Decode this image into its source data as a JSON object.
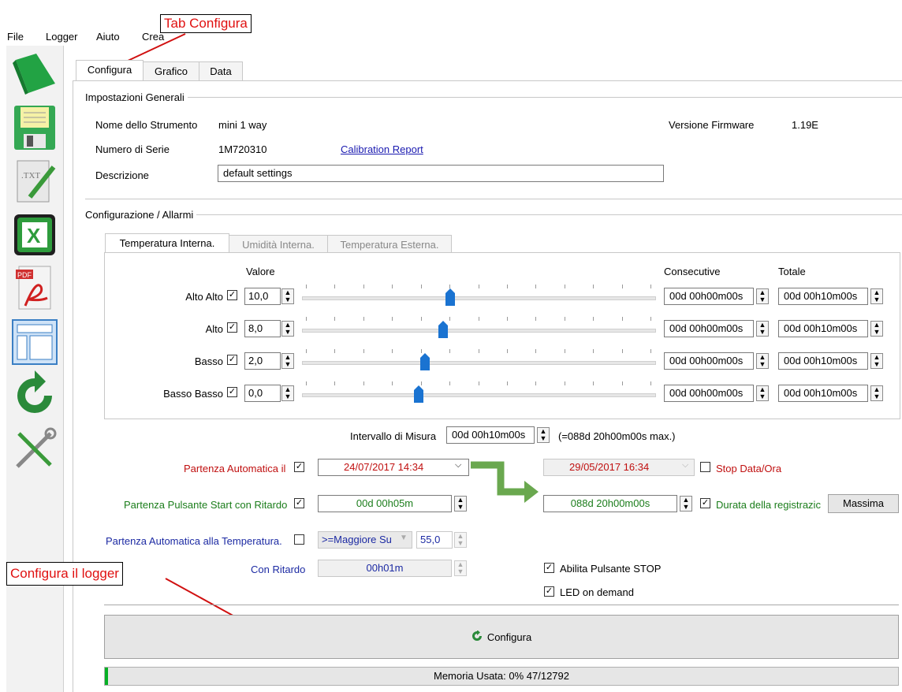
{
  "menu": [
    "File",
    "Logger",
    "Aiuto",
    "Crea"
  ],
  "callouts": {
    "tab": "Tab Configura",
    "logger": "Configura il logger"
  },
  "toolbar": [
    "open-icon",
    "save-icon",
    "txt-export-icon",
    "excel-export-icon",
    "pdf-export-icon",
    "layout-icon",
    "refresh-icon",
    "tools-icon"
  ],
  "tabs": [
    "Configura",
    "Grafico",
    "Data"
  ],
  "general": {
    "title": "Impostazioni Generali",
    "name_label": "Nome dello Strumento",
    "name_value": "mini 1 way",
    "firmware_label": "Versione Firmware",
    "firmware_value": "1.19E",
    "serial_label": "Numero di Serie",
    "serial_value": "1M720310",
    "calibration_link": "Calibration Report",
    "desc_label": "Descrizione",
    "desc_value": "default settings"
  },
  "alarms": {
    "title": "Configurazione / Allarmi",
    "tabs": [
      "Temperatura Interna.",
      "Umidità Interna.",
      "Temperatura Esterna."
    ],
    "col_value": "Valore",
    "col_consec": "Consecutive",
    "col_total": "Totale",
    "rows": [
      {
        "label": "Alto Alto",
        "value": "10,0",
        "consec": "00d 00h00m00s",
        "total": "00d 00h10m00s",
        "level": 0.42
      },
      {
        "label": "Alto",
        "value": "8,0",
        "consec": "00d 00h00m00s",
        "total": "00d 00h10m00s",
        "level": 0.4
      },
      {
        "label": "Basso",
        "value": "2,0",
        "consec": "00d 00h00m00s",
        "total": "00d 00h10m00s",
        "level": 0.35
      },
      {
        "label": "Basso Basso",
        "value": "0,0",
        "consec": "00d 00h00m00s",
        "total": "00d 00h10m00s",
        "level": 0.33
      }
    ]
  },
  "interval": {
    "label": "Intervallo di Misura",
    "value": "00d 00h10m00s",
    "max": "(=088d 20h00m00s max.)"
  },
  "auto_start": {
    "label": "Partenza Automatica il",
    "value": "24/07/2017 14:34"
  },
  "stop": {
    "value": "29/05/2017 16:34",
    "label": "Stop Data/Ora"
  },
  "button_start": {
    "label": "Partenza Pulsante Start con Ritardo",
    "value": "00d 00h05m"
  },
  "duration": {
    "value": "088d 20h00m00s",
    "label": "Durata della registrazic",
    "max_button": "Massima"
  },
  "temp_start": {
    "label": "Partenza Automatica alla Temperatura.",
    "mode": ">=Maggiore Su",
    "value": "55,0"
  },
  "delay": {
    "label": "Con Ritardo",
    "value": "00h01m"
  },
  "options": {
    "stop_button": "Abilita Pulsante STOP",
    "led": "LED on demand"
  },
  "configure_button": "Configura",
  "memory": {
    "label": "Memoria Usata: 0% 47/12792",
    "fraction": 0.004
  },
  "colors": {
    "accent": "#1a73d1",
    "callout": "#e01010",
    "green": "#1b7d1b",
    "red": "#c01010",
    "blue": "#1c2aa3"
  }
}
